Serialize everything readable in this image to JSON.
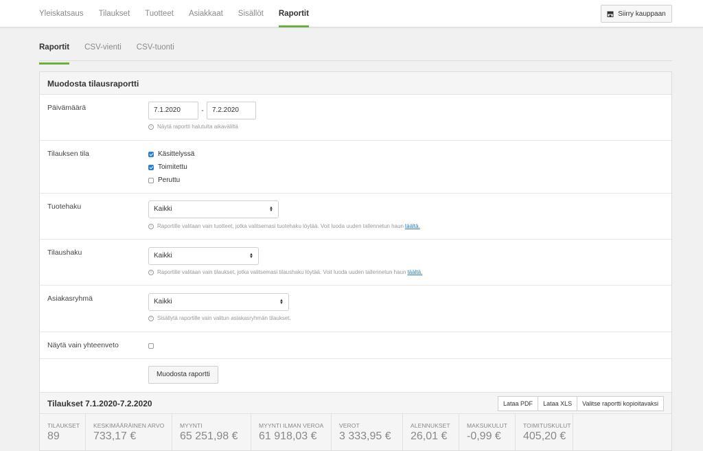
{
  "nav": {
    "items": [
      {
        "label": "Yleiskatsaus",
        "active": false
      },
      {
        "label": "Tilaukset",
        "active": false
      },
      {
        "label": "Tuotteet",
        "active": false
      },
      {
        "label": "Asiakkaat",
        "active": false
      },
      {
        "label": "Sisällöt",
        "active": false
      },
      {
        "label": "Raportit",
        "active": true
      }
    ],
    "shop_button": {
      "label": "Siirry kauppaan",
      "icon": "store-icon"
    }
  },
  "subtabs": [
    {
      "label": "Raportit",
      "active": true
    },
    {
      "label": "CSV-vienti",
      "active": false
    },
    {
      "label": "CSV-tuonti",
      "active": false
    }
  ],
  "form": {
    "title": "Muodosta tilausraportti",
    "date": {
      "label": "Päivämäärä",
      "from": "7.1.2020",
      "separator": "-",
      "to": "7.2.2020",
      "help": "Näytä raportti halutulta aikaväliltä"
    },
    "status": {
      "label": "Tilauksen tila",
      "options": [
        {
          "label": "Käsittelyssä",
          "checked": true
        },
        {
          "label": "Toimitettu",
          "checked": true
        },
        {
          "label": "Peruttu",
          "checked": false
        }
      ]
    },
    "product_search": {
      "label": "Tuotehaku",
      "value": "Kaikki",
      "help": "Raportille valitaan vain tuotteet, jotka valitsemasi tuotehaku löytää. Voit luoda uuden tallennetun haun",
      "link": "täältä."
    },
    "order_search": {
      "label": "Tilaushaku",
      "value": "Kaikki",
      "help": "Raportille valitaan vain tilaukset, jotka valitsemasi tilaushaku löytää. Voit luoda uuden tallennetun haun",
      "link": "täältä."
    },
    "customer_group": {
      "label": "Asiakasryhmä",
      "value": "Kaikki",
      "help": "Sisällytä raportille vain valitun asiakasryhmän tilaukset."
    },
    "summary_only": {
      "label": "Näytä vain yhteenveto",
      "checked": false
    },
    "submit_label": "Muodosta raportti"
  },
  "summary": {
    "title": "Tilaukset 7.1.2020-7.2.2020",
    "buttons": [
      "Lataa PDF",
      "Lataa XLS",
      "Valitse raportti kopioitavaksi"
    ],
    "stats": [
      {
        "label": "Tilaukset",
        "value": "89"
      },
      {
        "label": "Keskimääräinen arvo",
        "value": "733,17 €"
      },
      {
        "label": "Myynti",
        "value": "65 251,98 €"
      },
      {
        "label": "Myynti ilman veroa",
        "value": "61 918,03 €"
      },
      {
        "label": "Verot",
        "value": "3 333,95 €"
      },
      {
        "label": "Alennukset",
        "value": "26,01 €"
      },
      {
        "label": "Maksukulut",
        "value": "-0,99 €"
      },
      {
        "label": "Toimituskulut",
        "value": "405,20 €"
      }
    ]
  },
  "colors": {
    "accent": "#6aae3f",
    "checkbox": "#2b7fd6",
    "link": "#2a7bbd"
  }
}
